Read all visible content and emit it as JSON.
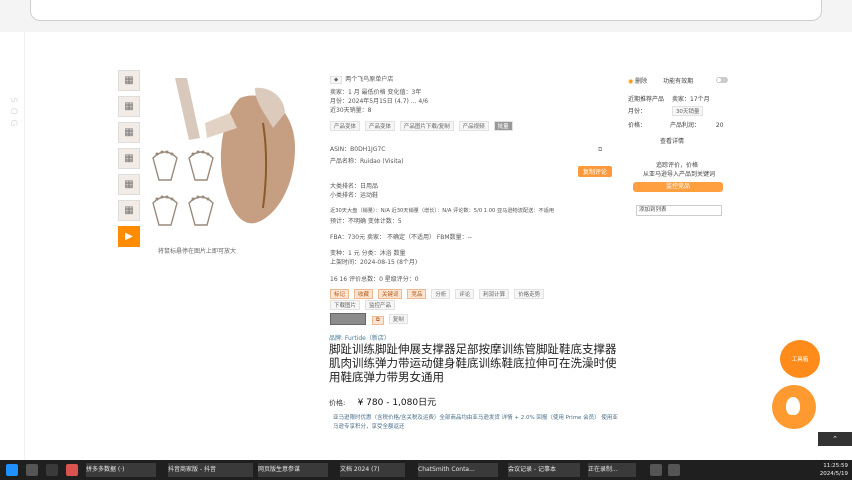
{
  "sidebar_left": {
    "vertical_text": "S O G"
  },
  "thumbnails": [
    {
      "icon": "image-icon"
    },
    {
      "icon": "image-icon"
    },
    {
      "icon": "image-icon"
    },
    {
      "icon": "image-icon"
    },
    {
      "icon": "image-icon"
    },
    {
      "icon": "image-icon"
    },
    {
      "icon": "video-icon"
    }
  ],
  "image_caption": "将鼠标悬停在图片上即可放大",
  "ext": {
    "header": "两个飞鸟原单户店",
    "seller_row": "卖家：1 月  最低价格  变化值：3年",
    "date_row": "月份：2024年5月15日  (4.7)  ...  4/6",
    "recent_row": "近30天销量：8",
    "tags": [
      "产品变体",
      "产品变体",
      "产品图片下载/复制",
      "产品视频",
      "批量"
    ],
    "asin": "ASIN：B0DH1JG7C",
    "brand": "产品名称：Ruidao  (Visita)",
    "bsr1": "大类排名：日用品",
    "bsr2": "小类排名：运动鞋",
    "review_row": "近30天大盘（销量）：N/A  近30天销量（增长）：N/A  评论数：5/0 1.00  亚马逊物流配送：不适用",
    "review_row2": "预计：不明确  变体计数：5",
    "stock_row": "FBA：730元  卖家：  不确定（不适用）  FBM数量：--",
    "qty_row": "变种：1 元  分类：沐浴  数量",
    "launch_row": "上架时间：2024-08-15 (8个月)",
    "stats_row": "16    16    评价总数：0    星级评分：0",
    "action_tags": [
      "标记",
      "收藏",
      "关键词",
      "竞品",
      "分析",
      "评论",
      "利润计算",
      "价格走势",
      "下载图片",
      "监控产品"
    ],
    "copy_label": "复制",
    "orange_label": "复制评论"
  },
  "store_link": "品牌: Furtide（新店）",
  "title": "脚趾训练脚趾伸展支撑器足部按摩训练管脚趾鞋底支撑器肌肉训练弹力带运动健身鞋底训练鞋底拉伸可在洗澡时使用鞋底弹力带男女通用",
  "price_label": "价格:",
  "price": "¥ 780 - 1,080日元",
  "promo": "亚马逊限时优惠（含税价格/含关税及运费）全部商品均由亚马逊发货  详情 + 2.0% 回报（使用 Prime 会员）  使用亚马逊专享积分，享受全额返还",
  "side_panel": {
    "row1_a": "删除",
    "row1_b": "功能有效期",
    "row2_label": "近期推荐产品",
    "row2_val": "卖家：17个月",
    "row3_a": "月份：",
    "row3_b": "30天销量",
    "row4_a": "价格：",
    "row4_b": "产品利润：",
    "row4_c": "20",
    "row5": "查看详情",
    "row6": "追踪评价，价格",
    "row7": "从亚马逊导入产品到关键词",
    "button": "监控竞品",
    "input": "添加到列表"
  },
  "float_widget": "工具箱",
  "taskbar": {
    "items": [
      "拼多多数据 (·)",
      "抖音商家版 - 抖音",
      "网页版生意参谋",
      "文档 2024 (7)",
      "ChatSmith Conta...",
      "会议记录 - 记事本",
      "正在录制..."
    ],
    "time": "11:25:59",
    "date": "2024/5/19"
  },
  "colors": {
    "accent": "#ff9a3c",
    "taskbar": "#1f1f1f"
  }
}
